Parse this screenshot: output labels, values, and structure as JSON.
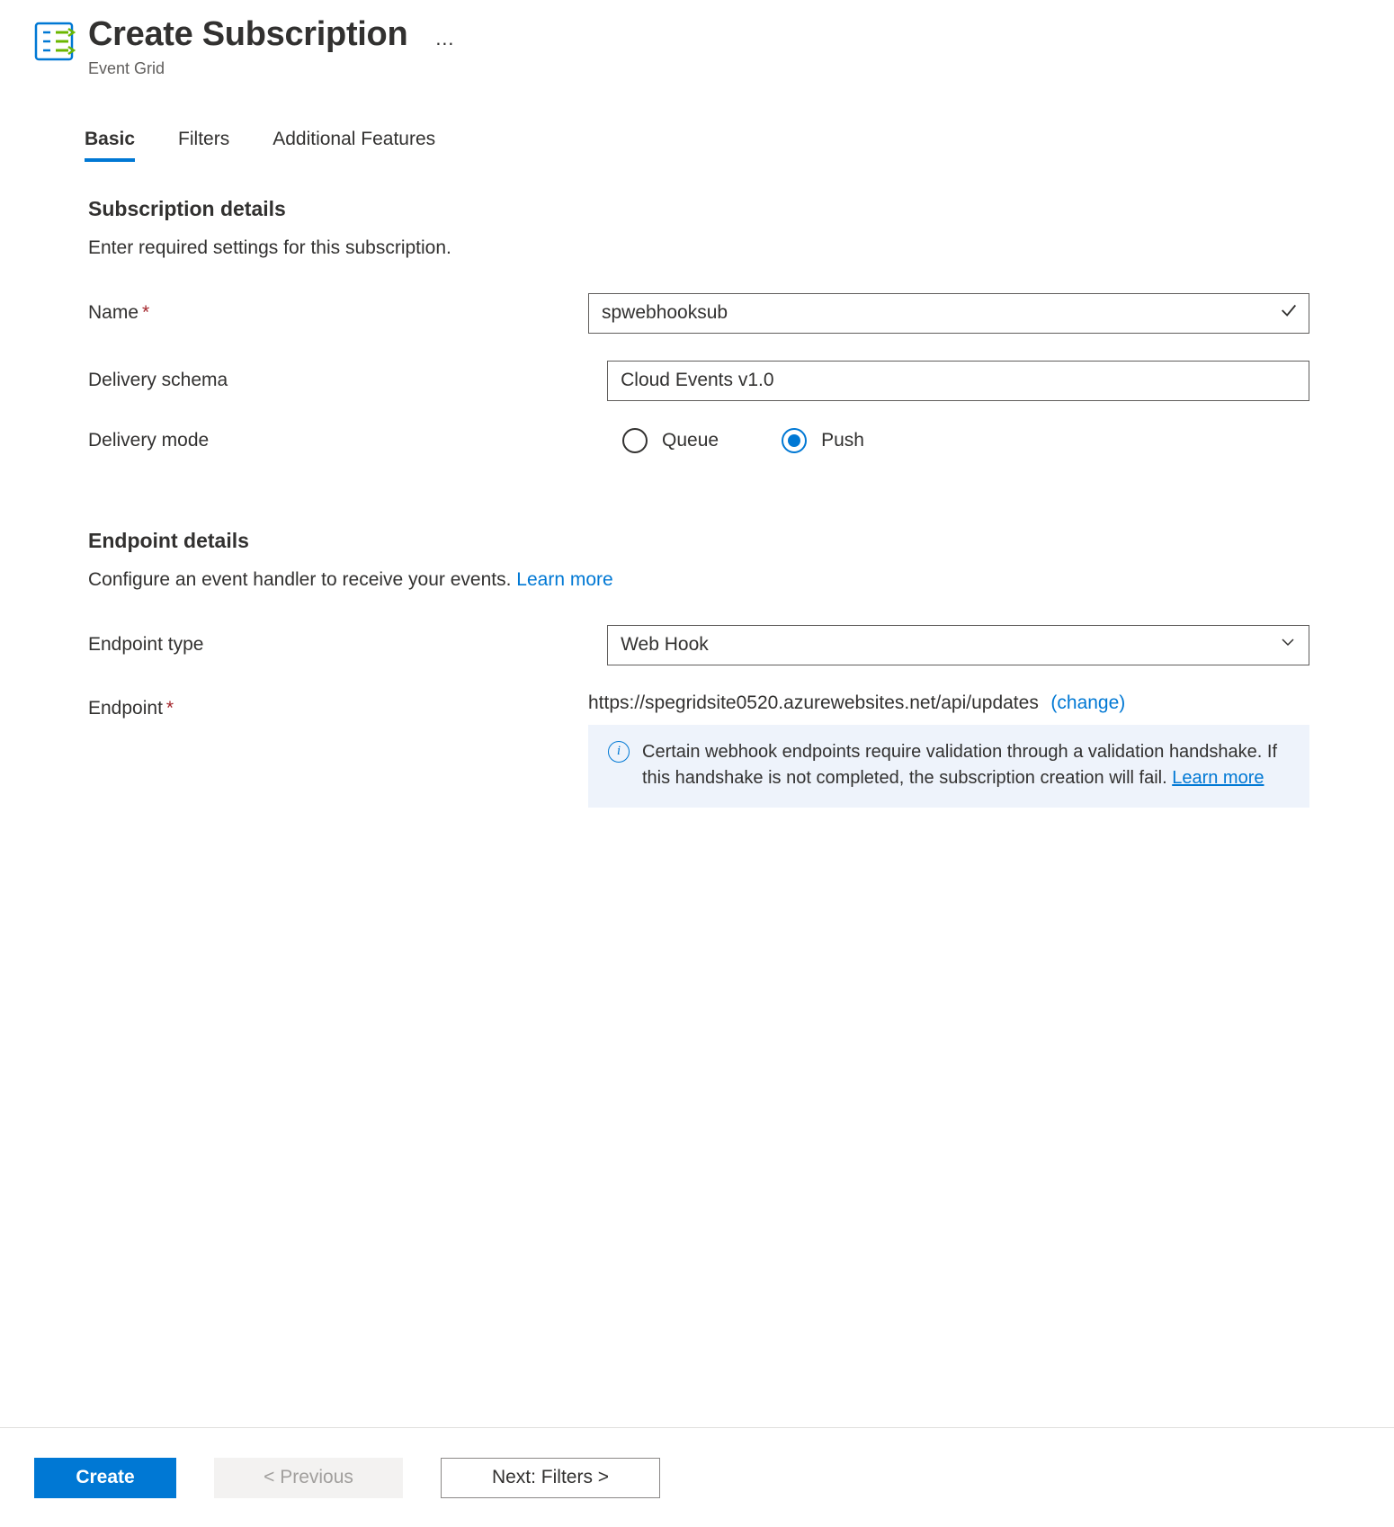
{
  "header": {
    "title": "Create Subscription",
    "subtitle": "Event Grid",
    "more": "…"
  },
  "tabs": [
    {
      "label": "Basic",
      "active": true
    },
    {
      "label": "Filters",
      "active": false
    },
    {
      "label": "Additional Features",
      "active": false
    }
  ],
  "subscription": {
    "section_title": "Subscription details",
    "section_desc": "Enter required settings for this subscription.",
    "name_label": "Name",
    "name_value": "spwebhooksub",
    "schema_label": "Delivery schema",
    "schema_value": "Cloud Events v1.0",
    "mode_label": "Delivery mode",
    "mode_options": [
      "Queue",
      "Push"
    ],
    "mode_selected": "Push"
  },
  "endpoint": {
    "section_title": "Endpoint details",
    "section_desc": "Configure an event handler to receive your events. ",
    "learn_more": "Learn more",
    "type_label": "Endpoint type",
    "type_value": "Web Hook",
    "endpoint_label": "Endpoint",
    "endpoint_value": "https://spegridsite0520.azurewebsites.net/api/updates",
    "change": "(change)",
    "info_text": "Certain webhook endpoints require validation through a validation handshake. If this handshake is not completed, the subscription creation will fail.  ",
    "info_learn_more": "Learn more"
  },
  "footer": {
    "create": "Create",
    "previous": "< Previous",
    "next": "Next: Filters >"
  }
}
